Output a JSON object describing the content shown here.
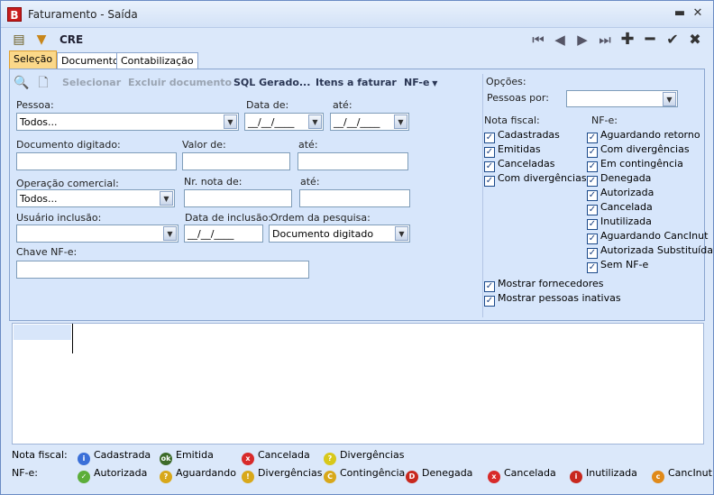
{
  "window": {
    "title": "Faturamento - Saída",
    "minimize": "▬",
    "close": "✕"
  },
  "toolbar": {
    "label": "CRE"
  },
  "tabs": [
    "Seleção",
    "Documento",
    "Contabilização"
  ],
  "actions": {
    "selecionar": "Selecionar",
    "excluir": "Excluir documento",
    "sql": "SQL Gerado...",
    "itens": "Itens a faturar",
    "nfe": "NF-e"
  },
  "form": {
    "pessoa_label": "Pessoa:",
    "pessoa_value": "Todos...",
    "data_de_label": "Data de:",
    "data_de_value": "__/__/____",
    "ate_label": "até:",
    "ate_value": "__/__/____",
    "doc_label": "Documento digitado:",
    "valor_label": "Valor de:",
    "valor_ate_label": "até:",
    "operacao_label": "Operação comercial:",
    "operacao_value": "Todos...",
    "nr_nota_label": "Nr. nota de:",
    "nr_ate_label": "até:",
    "usuario_label": "Usuário inclusão:",
    "data_inclusao_label": "Data de inclusão:",
    "data_inclusao_value": "__/__/____",
    "ordem_label": "Ordem da pesquisa:",
    "ordem_value": "Documento digitado",
    "chave_label": "Chave NF-e:"
  },
  "options": {
    "title": "Opções:",
    "pessoas_por_label": "Pessoas por:",
    "nota_fiscal_label": "Nota fiscal:",
    "nota_fiscal_items": [
      "Cadastradas",
      "Emitidas",
      "Canceladas",
      "Com divergências"
    ],
    "nfe_label": "NF-e:",
    "nfe_items": [
      "Aguardando retorno",
      "Com divergências",
      "Em contingência",
      "Denegada",
      "Autorizada",
      "Cancelada",
      "Inutilizada",
      "Aguardando CancInut",
      "Autorizada Substituída",
      "Sem NF-e"
    ],
    "extra_items": [
      "Mostrar fornecedores",
      "Mostrar pessoas inativas"
    ]
  },
  "legend": {
    "nota_label": "Nota fiscal:",
    "nota_items": [
      {
        "label": "Cadastrada",
        "icon": "info-icon",
        "color": "#3a6fd8",
        "glyph": "i"
      },
      {
        "label": "Emitida",
        "icon": "ok-icon",
        "color": "#3d6b2a",
        "glyph": "ok"
      },
      {
        "label": "Cancelada",
        "icon": "cancel-icon",
        "color": "#d82a2a",
        "glyph": "x"
      },
      {
        "label": "Divergências",
        "icon": "divergence-icon",
        "color": "#d8c81a",
        "glyph": "?"
      }
    ],
    "nfe_label": "NF-e:",
    "nfe_items": [
      {
        "label": "Autorizada",
        "icon": "authorized-icon",
        "color": "#5cae3a",
        "glyph": "✓"
      },
      {
        "label": "Aguardando",
        "icon": "waiting-icon",
        "color": "#d8a81a",
        "glyph": "?"
      },
      {
        "label": "Divergências",
        "icon": "warning-icon",
        "color": "#d8a81a",
        "glyph": "!"
      },
      {
        "label": "Contingência",
        "icon": "contingency-icon",
        "color": "#d8a81a",
        "glyph": "C"
      },
      {
        "label": "Denegada",
        "icon": "denied-icon",
        "color": "#c8281e",
        "glyph": "D"
      },
      {
        "label": "Cancelada",
        "icon": "nfe-cancel-icon",
        "color": "#d82a2a",
        "glyph": "x"
      },
      {
        "label": "Inutilizada",
        "icon": "unused-icon",
        "color": "#c8281e",
        "glyph": "i"
      },
      {
        "label": "CancInut",
        "icon": "cancinut-icon",
        "color": "#e08a1a",
        "glyph": "c"
      }
    ]
  }
}
